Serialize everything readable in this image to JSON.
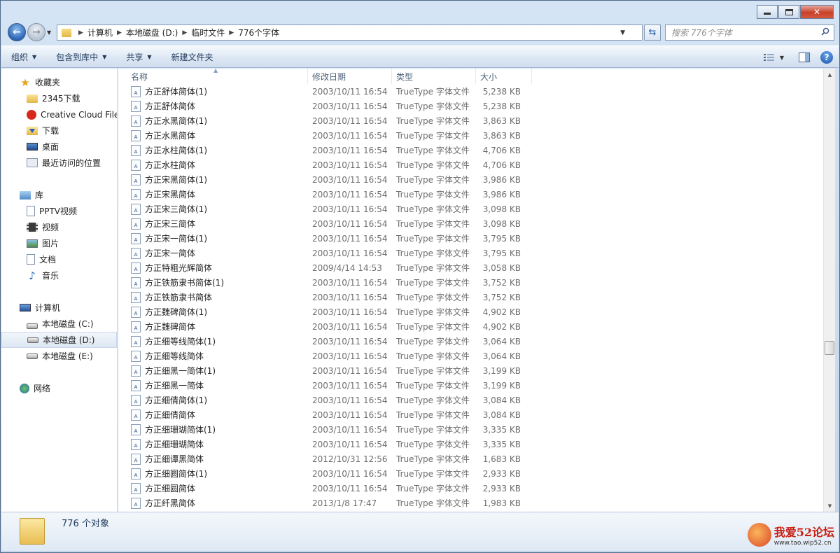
{
  "address": {
    "crumbs": [
      "计算机",
      "本地磁盘 (D:)",
      "临时文件",
      "776个字体"
    ]
  },
  "search": {
    "placeholder": "搜索 776个字体"
  },
  "toolbar": {
    "organize": "组织",
    "include_in_library": "包含到库中",
    "share": "共享",
    "new_folder": "新建文件夹"
  },
  "nav": {
    "favorites": {
      "label": "收藏夹",
      "items": [
        "2345下载",
        "Creative Cloud Files",
        "下载",
        "桌面",
        "最近访问的位置"
      ]
    },
    "libraries": {
      "label": "库",
      "items": [
        "PPTV视频",
        "视频",
        "图片",
        "文档",
        "音乐"
      ]
    },
    "computer": {
      "label": "计算机",
      "items": [
        "本地磁盘 (C:)",
        "本地磁盘 (D:)",
        "本地磁盘 (E:)"
      ],
      "selected": "本地磁盘 (D:)"
    },
    "network": {
      "label": "网络"
    }
  },
  "columns": {
    "name": "名称",
    "date": "修改日期",
    "type": "类型",
    "size": "大小"
  },
  "files": [
    {
      "name": "方正舒体简体(1)",
      "date": "2003/10/11 16:54",
      "type": "TrueType 字体文件",
      "size": "5,238 KB"
    },
    {
      "name": "方正舒体简体",
      "date": "2003/10/11 16:54",
      "type": "TrueType 字体文件",
      "size": "5,238 KB"
    },
    {
      "name": "方正水黑简体(1)",
      "date": "2003/10/11 16:54",
      "type": "TrueType 字体文件",
      "size": "3,863 KB"
    },
    {
      "name": "方正水黑简体",
      "date": "2003/10/11 16:54",
      "type": "TrueType 字体文件",
      "size": "3,863 KB"
    },
    {
      "name": "方正水柱简体(1)",
      "date": "2003/10/11 16:54",
      "type": "TrueType 字体文件",
      "size": "4,706 KB"
    },
    {
      "name": "方正水柱简体",
      "date": "2003/10/11 16:54",
      "type": "TrueType 字体文件",
      "size": "4,706 KB"
    },
    {
      "name": "方正宋黑简体(1)",
      "date": "2003/10/11 16:54",
      "type": "TrueType 字体文件",
      "size": "3,986 KB"
    },
    {
      "name": "方正宋黑简体",
      "date": "2003/10/11 16:54",
      "type": "TrueType 字体文件",
      "size": "3,986 KB"
    },
    {
      "name": "方正宋三简体(1)",
      "date": "2003/10/11 16:54",
      "type": "TrueType 字体文件",
      "size": "3,098 KB"
    },
    {
      "name": "方正宋三简体",
      "date": "2003/10/11 16:54",
      "type": "TrueType 字体文件",
      "size": "3,098 KB"
    },
    {
      "name": "方正宋一简体(1)",
      "date": "2003/10/11 16:54",
      "type": "TrueType 字体文件",
      "size": "3,795 KB"
    },
    {
      "name": "方正宋一简体",
      "date": "2003/10/11 16:54",
      "type": "TrueType 字体文件",
      "size": "3,795 KB"
    },
    {
      "name": "方正特粗光辉简体",
      "date": "2009/4/14 14:53",
      "type": "TrueType 字体文件",
      "size": "3,058 KB"
    },
    {
      "name": "方正铁筋隶书简体(1)",
      "date": "2003/10/11 16:54",
      "type": "TrueType 字体文件",
      "size": "3,752 KB"
    },
    {
      "name": "方正铁筋隶书简体",
      "date": "2003/10/11 16:54",
      "type": "TrueType 字体文件",
      "size": "3,752 KB"
    },
    {
      "name": "方正魏碑简体(1)",
      "date": "2003/10/11 16:54",
      "type": "TrueType 字体文件",
      "size": "4,902 KB"
    },
    {
      "name": "方正魏碑简体",
      "date": "2003/10/11 16:54",
      "type": "TrueType 字体文件",
      "size": "4,902 KB"
    },
    {
      "name": "方正细等线简体(1)",
      "date": "2003/10/11 16:54",
      "type": "TrueType 字体文件",
      "size": "3,064 KB"
    },
    {
      "name": "方正细等线简体",
      "date": "2003/10/11 16:54",
      "type": "TrueType 字体文件",
      "size": "3,064 KB"
    },
    {
      "name": "方正细黑一简体(1)",
      "date": "2003/10/11 16:54",
      "type": "TrueType 字体文件",
      "size": "3,199 KB"
    },
    {
      "name": "方正细黑一简体",
      "date": "2003/10/11 16:54",
      "type": "TrueType 字体文件",
      "size": "3,199 KB"
    },
    {
      "name": "方正细倩简体(1)",
      "date": "2003/10/11 16:54",
      "type": "TrueType 字体文件",
      "size": "3,084 KB"
    },
    {
      "name": "方正细倩简体",
      "date": "2003/10/11 16:54",
      "type": "TrueType 字体文件",
      "size": "3,084 KB"
    },
    {
      "name": "方正细珊瑚简体(1)",
      "date": "2003/10/11 16:54",
      "type": "TrueType 字体文件",
      "size": "3,335 KB"
    },
    {
      "name": "方正细珊瑚简体",
      "date": "2003/10/11 16:54",
      "type": "TrueType 字体文件",
      "size": "3,335 KB"
    },
    {
      "name": "方正细谭黑简体",
      "date": "2012/10/31 12:56",
      "type": "TrueType 字体文件",
      "size": "1,683 KB"
    },
    {
      "name": "方正细圆简体(1)",
      "date": "2003/10/11 16:54",
      "type": "TrueType 字体文件",
      "size": "2,933 KB"
    },
    {
      "name": "方正细圆简体",
      "date": "2003/10/11 16:54",
      "type": "TrueType 字体文件",
      "size": "2,933 KB"
    },
    {
      "name": "方正纤黑简体",
      "date": "2013/1/8 17:47",
      "type": "TrueType 字体文件",
      "size": "1,983 KB"
    }
  ],
  "status": {
    "count_text": "776 个对象"
  },
  "watermark": {
    "title": "我爱52论坛",
    "url": "www.tao.wip52.cn"
  }
}
